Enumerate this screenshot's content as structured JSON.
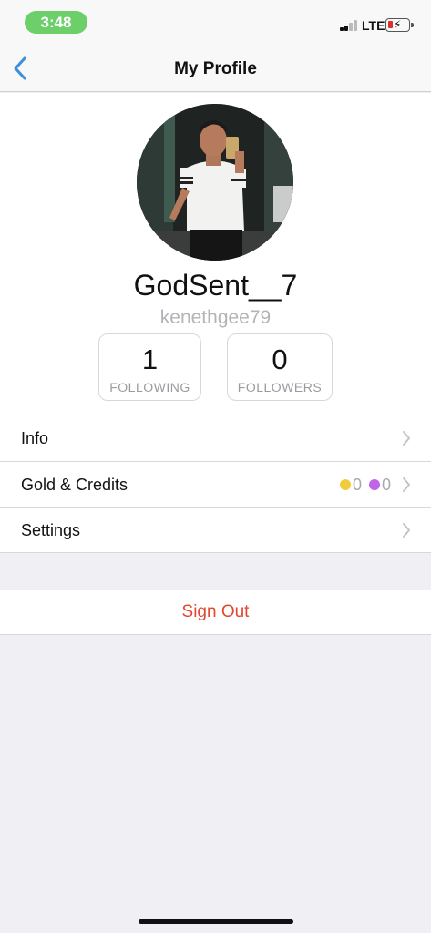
{
  "status_bar": {
    "time": "3:48",
    "network": "LTE",
    "time_pill_color": "#6ccf6a",
    "battery_color": "#e0302a"
  },
  "nav": {
    "title": "My Profile",
    "back_icon": "chevron-left-icon",
    "accent_color": "#3d8fd9"
  },
  "profile": {
    "display_name": "GodSent__7",
    "username": "kenethgee79",
    "stats": [
      {
        "value": "1",
        "label": "FOLLOWING"
      },
      {
        "value": "0",
        "label": "FOLLOWERS"
      }
    ]
  },
  "menu": {
    "items": [
      {
        "label": "Info"
      },
      {
        "label": "Gold & Credits",
        "gold": "0",
        "credits": "0"
      },
      {
        "label": "Settings"
      }
    ]
  },
  "sign_out": {
    "label": "Sign Out",
    "color": "#e0472e"
  }
}
